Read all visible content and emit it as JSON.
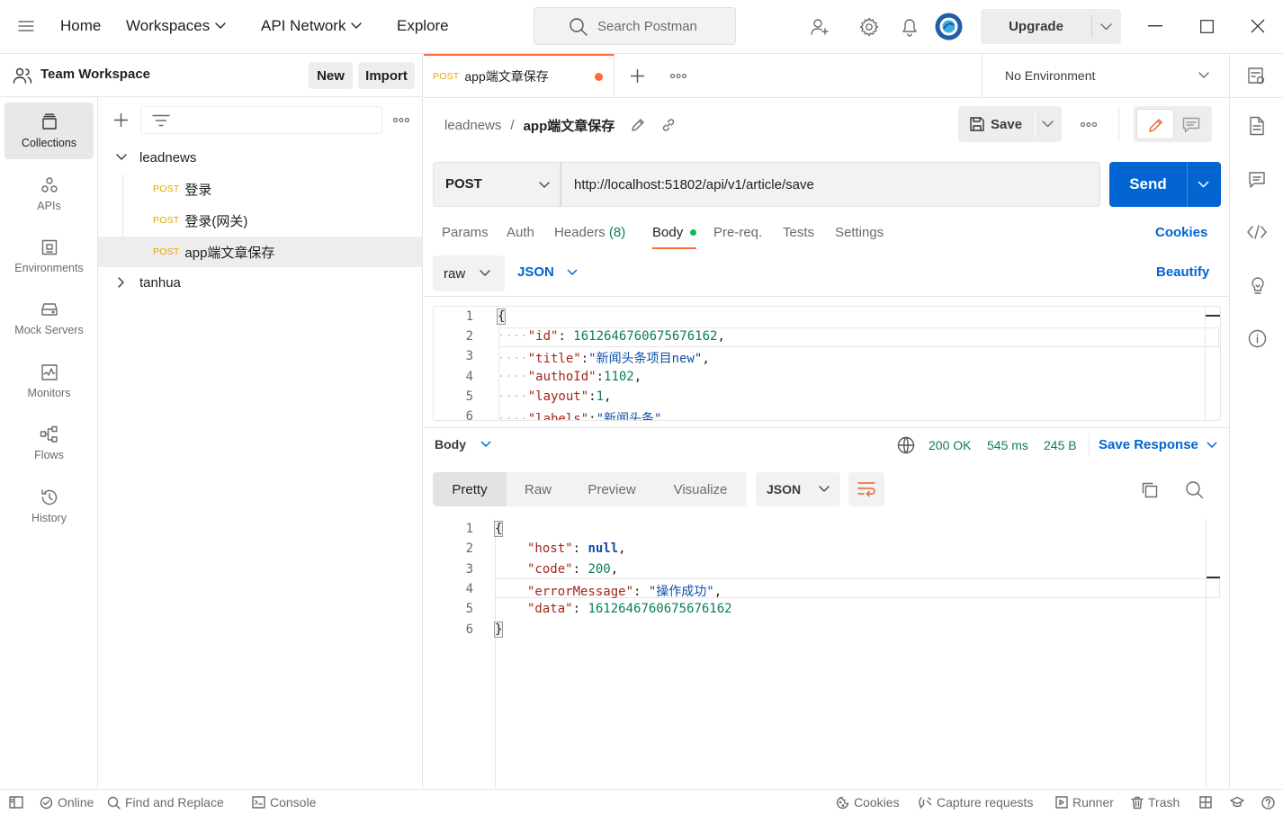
{
  "topbar": {
    "nav": {
      "home": "Home",
      "workspaces": "Workspaces",
      "api_network": "API Network",
      "explore": "Explore"
    },
    "search_placeholder": "Search Postman",
    "upgrade": "Upgrade"
  },
  "workspace": {
    "name": "Team Workspace",
    "new_label": "New",
    "import_label": "Import"
  },
  "rail": {
    "collections": "Collections",
    "apis": "APIs",
    "environments": "Environments",
    "mock_servers": "Mock Servers",
    "monitors": "Monitors",
    "flows": "Flows",
    "history": "History"
  },
  "tree": {
    "collections": [
      {
        "name": "leadnews",
        "expanded": true,
        "requests": [
          {
            "method": "POST",
            "name": "登录"
          },
          {
            "method": "POST",
            "name": "登录(网关)"
          },
          {
            "method": "POST",
            "name": "app端文章保存",
            "selected": true
          }
        ]
      },
      {
        "name": "tanhua",
        "expanded": false
      }
    ]
  },
  "tab": {
    "method": "POST",
    "name": "app端文章保存"
  },
  "environment": "No Environment",
  "breadcrumb": {
    "collection": "leadnews",
    "separator": "/",
    "request": "app端文章保存"
  },
  "actions": {
    "save": "Save"
  },
  "request": {
    "method": "POST",
    "url": "http://localhost:51802/api/v1/article/save",
    "send": "Send"
  },
  "request_tabs": {
    "params": "Params",
    "auth": "Auth",
    "headers": "Headers",
    "headers_count": "(8)",
    "body": "Body",
    "prereq": "Pre-req.",
    "tests": "Tests",
    "settings": "Settings",
    "cookies": "Cookies"
  },
  "body_options": {
    "mode": "raw",
    "lang": "JSON",
    "beautify": "Beautify"
  },
  "request_body": {
    "line_numbers": [
      "1",
      "2",
      "3",
      "4",
      "5",
      "6"
    ],
    "brace_open": "{",
    "id_key": "\"id\"",
    "id_colon": ": ",
    "id_val": "1612646760675676162",
    "id_comma": ",",
    "title_key": "\"title\"",
    "title_colon": ":",
    "title_val": "\"新闻头条项目new\"",
    "title_comma": ",",
    "autho_key": "\"authoId\"",
    "autho_colon": ":",
    "autho_val": "1102",
    "autho_comma": ",",
    "layout_key": "\"layout\"",
    "layout_colon": ":",
    "layout_val": "1",
    "layout_comma": ",",
    "labels_key": "\"labels\"",
    "labels_colon": ":",
    "labels_val": "\"新闻头条\""
  },
  "response": {
    "body_label": "Body",
    "status": "200 OK",
    "time": "545 ms",
    "size": "245 B",
    "save_response": "Save Response",
    "view_tabs": {
      "pretty": "Pretty",
      "raw": "Raw",
      "preview": "Preview",
      "visualize": "Visualize"
    },
    "format": "JSON",
    "line_numbers": [
      "1",
      "2",
      "3",
      "4",
      "5",
      "6"
    ],
    "brace_open": "{",
    "brace_close": "}",
    "host_key": "\"host\"",
    "host_val": "null",
    "code_key": "\"code\"",
    "code_val": "200",
    "err_key": "\"errorMessage\"",
    "err_val": "\"操作成功\"",
    "data_key": "\"data\"",
    "data_val": "1612646760675676162",
    "colon": ": ",
    "comma": ","
  },
  "statusbar": {
    "online": "Online",
    "find_replace": "Find and Replace",
    "console": "Console",
    "cookies": "Cookies",
    "capture": "Capture requests",
    "runner": "Runner",
    "trash": "Trash"
  },
  "colors": {
    "accent": "#0265d2",
    "post": "#e5a500",
    "status_ok": "#0a7d5b",
    "tab_dot": "#ff6c37",
    "body_dot": "#0cbb52"
  }
}
